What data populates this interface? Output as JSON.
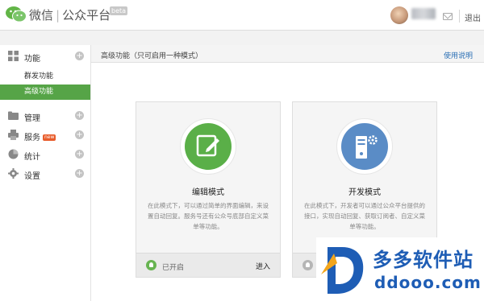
{
  "header": {
    "brand_primary": "微信",
    "brand_divider": "|",
    "brand_secondary": "公众平台",
    "beta_badge": "beta",
    "logout_label": "退出"
  },
  "sidebar": {
    "groups": [
      {
        "label": "功能",
        "icon": "grid-icon"
      },
      {
        "label": "管理",
        "icon": "folder-icon"
      },
      {
        "label": "服务",
        "icon": "print-icon",
        "badge": "new"
      },
      {
        "label": "统计",
        "icon": "pie-chart-icon"
      },
      {
        "label": "设置",
        "icon": "gear-icon"
      }
    ],
    "sub_items": [
      {
        "label": "群发功能",
        "active": false
      },
      {
        "label": "高级功能",
        "active": true
      }
    ]
  },
  "main": {
    "title": "高级功能（只可启用一种模式）",
    "help_link": "使用说明",
    "cards": [
      {
        "title": "编辑模式",
        "description": "在此模式下，可以通过简单的界面编辑，来设置自动回复。服务号还有公众号底部自定义菜单等功能。",
        "status": "已开启",
        "action": "进入",
        "icon": "edit-icon"
      },
      {
        "title": "开发模式",
        "description": "在此模式下，开发者可以通过公众平台提供的接口，实现自动回复、获取订阅者、自定义菜单等功能。",
        "status": "",
        "action": "",
        "icon": "server-gear-icon"
      }
    ]
  },
  "watermark": {
    "name": "多多软件站",
    "url": "ddooo.com"
  },
  "colors": {
    "accent_green": "#56a447",
    "dev_blue": "#5a8cc6",
    "link_blue": "#2a6fb4"
  }
}
